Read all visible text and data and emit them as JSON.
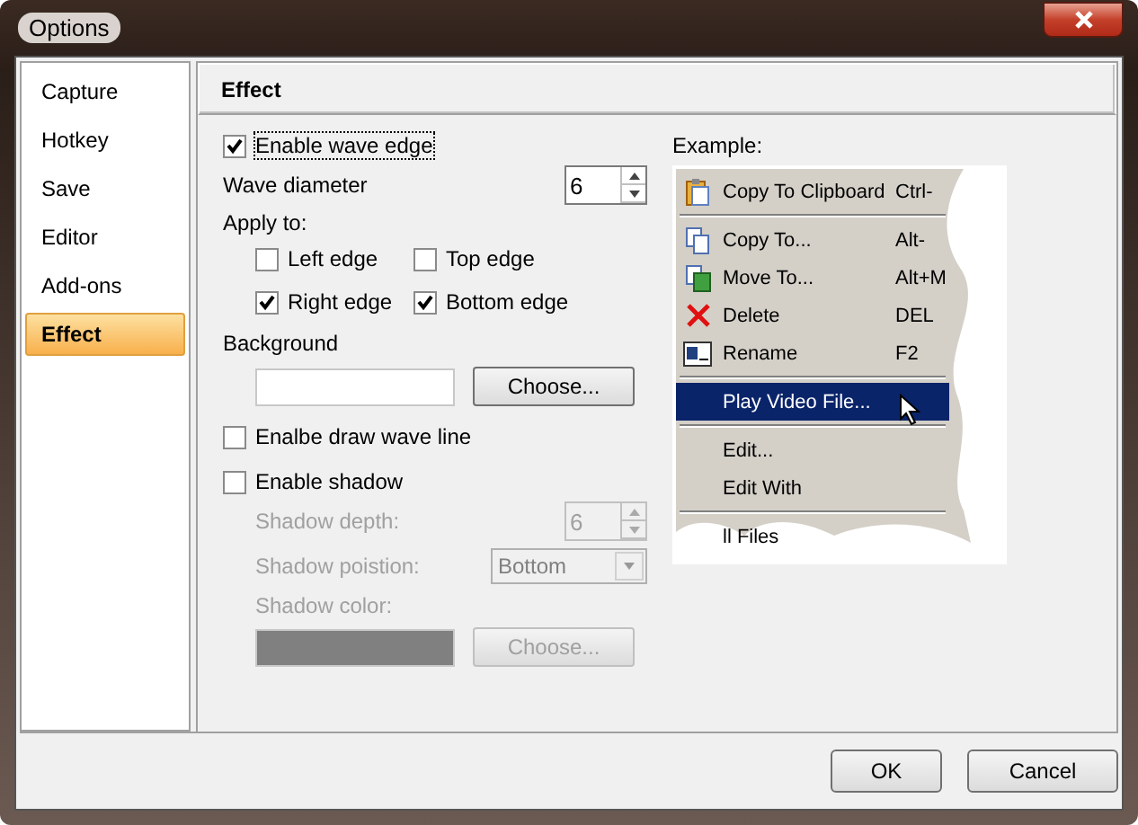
{
  "window": {
    "title": "Options"
  },
  "sidebar": {
    "items": [
      {
        "label": "Capture",
        "selected": false
      },
      {
        "label": "Hotkey",
        "selected": false
      },
      {
        "label": "Save",
        "selected": false
      },
      {
        "label": "Editor",
        "selected": false
      },
      {
        "label": "Add-ons",
        "selected": false
      },
      {
        "label": "Effect",
        "selected": true
      }
    ]
  },
  "panel": {
    "title": "Effect"
  },
  "wave": {
    "enable": {
      "label": "Enable wave edge",
      "checked": true
    },
    "diameter": {
      "label": "Wave diameter",
      "value": "6"
    },
    "apply_to": {
      "label": "Apply to:",
      "edges": [
        {
          "label": "Left edge",
          "checked": false
        },
        {
          "label": "Top edge",
          "checked": false
        },
        {
          "label": "Right edge",
          "checked": true
        },
        {
          "label": "Bottom edge",
          "checked": true
        }
      ]
    }
  },
  "background": {
    "label": "Background",
    "button": "Choose..."
  },
  "draw_wave_line": {
    "label": "Enalbe draw wave line",
    "checked": false
  },
  "shadow": {
    "enable": {
      "label": "Enable shadow",
      "checked": false
    },
    "depth": {
      "label": "Shadow depth:",
      "value": "6"
    },
    "position": {
      "label": "Shadow poistion:",
      "value": "Bottom"
    },
    "color": {
      "label": "Shadow color:",
      "button": "Choose..."
    }
  },
  "example": {
    "label": "Example:",
    "menu": [
      {
        "kind": "item",
        "label": "Copy To Clipboard",
        "shortcut": "Ctrl-",
        "selected": false
      },
      {
        "kind": "separator"
      },
      {
        "kind": "item",
        "label": "Copy To...",
        "shortcut": "Alt-",
        "selected": false
      },
      {
        "kind": "item",
        "label": "Move To...",
        "shortcut": "Alt+M",
        "selected": false
      },
      {
        "kind": "item",
        "label": "Delete",
        "shortcut": "DEL",
        "selected": false
      },
      {
        "kind": "item",
        "label": "Rename",
        "shortcut": "F2",
        "selected": false
      },
      {
        "kind": "separator"
      },
      {
        "kind": "item",
        "label": "Play Video File...",
        "selected": true
      },
      {
        "kind": "separator"
      },
      {
        "kind": "item",
        "label": "Edit...",
        "selected": false
      },
      {
        "kind": "item",
        "label": "Edit With",
        "selected": false
      },
      {
        "kind": "separator"
      },
      {
        "kind": "item",
        "label": "ll Files",
        "selected": false
      }
    ]
  },
  "buttons": [
    {
      "label": "OK"
    },
    {
      "label": "Cancel"
    }
  ]
}
